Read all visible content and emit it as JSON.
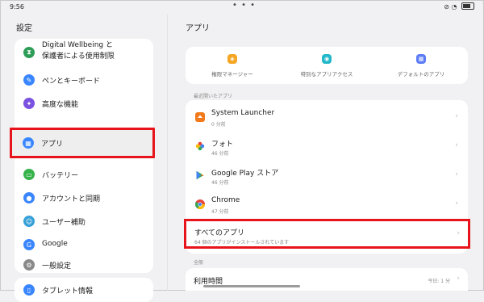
{
  "status": {
    "time": "9:56",
    "dots": "• • •"
  },
  "left": {
    "title": "設定",
    "items": [
      {
        "line1": "Digital Wellbeing と",
        "line2": "保護者による使用制限",
        "icon": "hourglass-icon",
        "color": "#2e9d57"
      },
      {
        "label": "ペンとキーボード",
        "icon": "pen-icon",
        "color": "#3a86ff"
      },
      {
        "label": "高度な機能",
        "icon": "star-icon",
        "color": "#7b52e0"
      },
      {
        "label": "アプリ",
        "icon": "apps-grid-icon",
        "color": "#3a86ff"
      },
      {
        "label": "バッテリー",
        "icon": "battery-icon",
        "color": "#35b34a"
      },
      {
        "label": "アカウントと同期",
        "icon": "person-icon",
        "color": "#3a86ff"
      },
      {
        "label": "ユーザー補助",
        "icon": "accessibility-icon",
        "color": "#37a0d8"
      },
      {
        "label": "Google",
        "icon": "google-icon",
        "color": "#3a86ff"
      },
      {
        "label": "一般設定",
        "icon": "gear-icon",
        "color": "#8a8a8a"
      }
    ],
    "tablet_info": {
      "label": "タブレット情報",
      "icon": "tablet-icon",
      "color": "#3a86ff"
    }
  },
  "right": {
    "title": "アプリ",
    "quick": [
      {
        "label": "権限マネージャー",
        "icon": "shield-icon",
        "color": "#f5a623"
      },
      {
        "label": "特別なアプリアクセス",
        "icon": "key-icon",
        "color": "#22b8c8"
      },
      {
        "label": "デフォルトのアプリ",
        "icon": "grid-icon",
        "color": "#5b7cf5"
      }
    ],
    "recent_label": "最近開いたアプリ",
    "recent": [
      {
        "name": "System Launcher",
        "sub": "0 分前",
        "icon": "launcher-icon"
      },
      {
        "name": "フォト",
        "sub": "46 分前",
        "icon": "photos-icon"
      },
      {
        "name": "Google Play ストア",
        "sub": "46 分前",
        "icon": "play-store-icon"
      },
      {
        "name": "Chrome",
        "sub": "47 分前",
        "icon": "chrome-icon"
      }
    ],
    "all_apps": {
      "title": "すべてのアプリ",
      "sub": "64 個のアプリがインストールされています"
    },
    "general_label": "全般",
    "usage": {
      "title": "利用時間",
      "value": "今日: 1 分"
    }
  }
}
